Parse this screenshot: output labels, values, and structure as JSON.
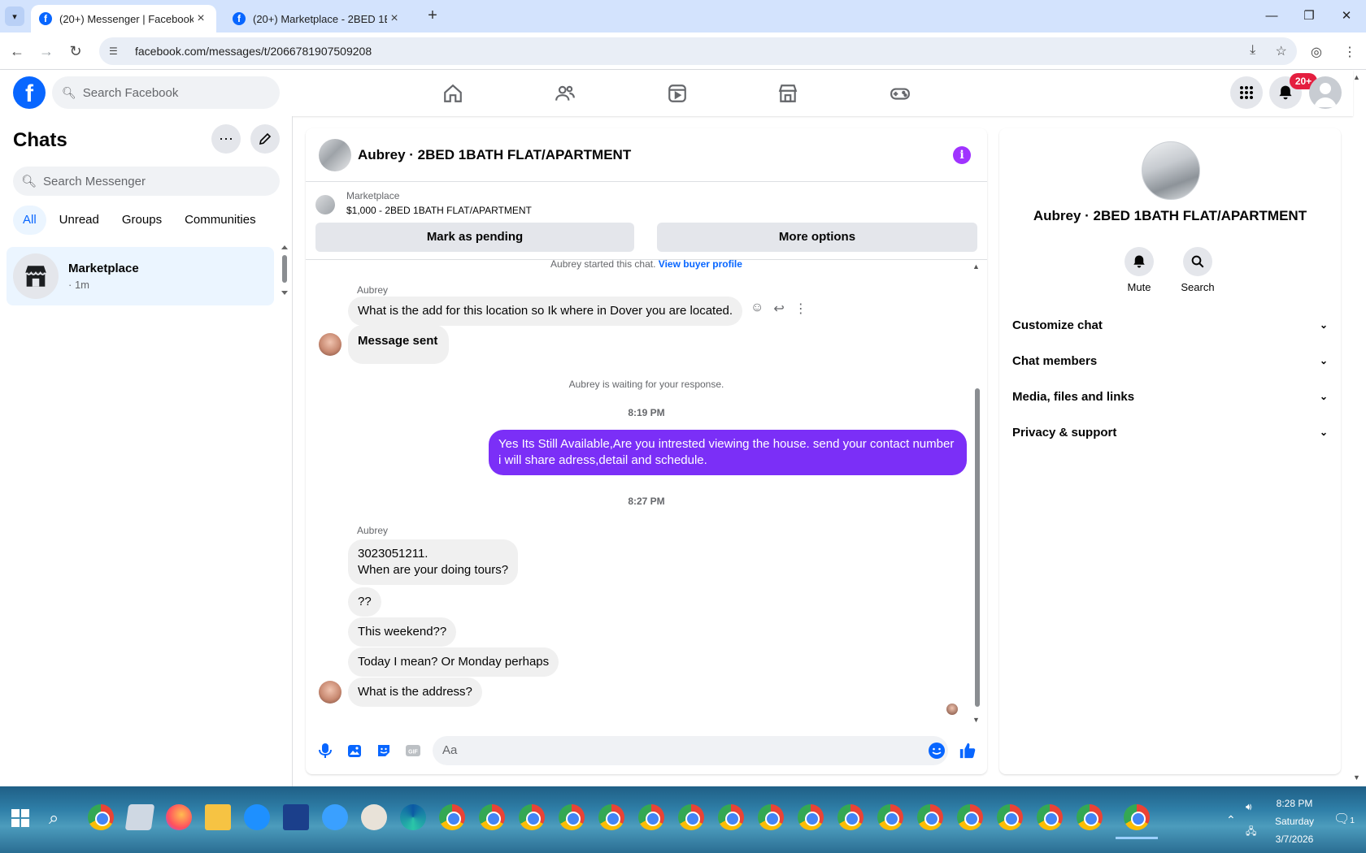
{
  "browser": {
    "tabs": [
      {
        "title": "(20+) Messenger | Facebook",
        "active": true
      },
      {
        "title": "(20+) Marketplace - 2BED 1BAT",
        "active": false
      }
    ],
    "url": "facebook.com/messages/t/2066781907509208"
  },
  "fb_header": {
    "search_placeholder": "Search Facebook",
    "notification_badge": "20+",
    "nav_icons": [
      "home-icon",
      "friends-icon",
      "video-icon",
      "marketplace-icon",
      "gaming-icon"
    ]
  },
  "chats_panel": {
    "title": "Chats",
    "search_placeholder": "Search Messenger",
    "filters": [
      "All",
      "Unread",
      "Groups",
      "Communities"
    ],
    "active_filter": "All",
    "items": [
      {
        "name": "Marketplace",
        "sub": "· 1m"
      }
    ]
  },
  "conversation": {
    "title": "Aubrey · 2BED 1BATH FLAT/APARTMENT",
    "marketplace_label": "Marketplace",
    "listing": "$1,000 - 2BED 1BATH FLAT/APARTMENT",
    "mark_pending": "Mark as pending",
    "more_options": "More options",
    "started_text": "Aubrey started this chat.",
    "view_buyer": "View buyer profile",
    "sender_name": "Aubrey",
    "msg1": "What is the add for this location so Ik where in Dover you are located.",
    "msg2": "Message sent",
    "waiting": "Aubrey is waiting for your response.",
    "time1": "8:19 PM",
    "my_msg": "Yes Its Still Available,Are you intrested viewing the house. send your contact number i will share adress,detail and schedule.",
    "time2": "8:27 PM",
    "msg3_line1": "3023051211.",
    "msg3_line2": "When are your doing tours?",
    "msg4": "??",
    "msg5": "This weekend??",
    "msg6": "Today I mean? Or Monday perhaps",
    "msg7": "What is the address?",
    "composer_placeholder": "Aa"
  },
  "details_panel": {
    "name": "Aubrey · 2BED 1BATH FLAT/APARTMENT",
    "mute_label": "Mute",
    "search_label": "Search",
    "sections": [
      "Customize chat",
      "Chat members",
      "Media, files and links",
      "Privacy & support"
    ]
  },
  "taskbar": {
    "time": "8:28 PM",
    "day": "Saturday",
    "date": "3/7/2026",
    "notif_count": "1"
  },
  "colors": {
    "fb_blue": "#0866ff",
    "my_bubble": "#7b2ff7",
    "badge_red": "#e41e3f"
  }
}
